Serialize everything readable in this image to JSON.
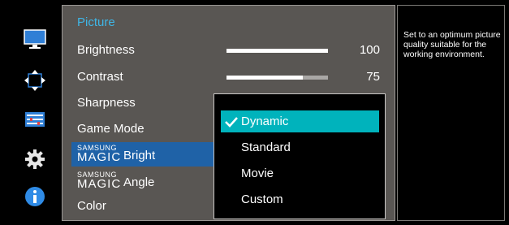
{
  "menu": {
    "title": "Picture",
    "items": [
      {
        "label": "Brightness",
        "value": "100",
        "level": 1.0
      },
      {
        "label": "Contrast",
        "value": "75",
        "level": 0.75
      },
      {
        "label": "Sharpness"
      },
      {
        "label": "Game Mode"
      }
    ],
    "magic_bright": {
      "brand": "SAMSUNG",
      "magic": "MAGIC",
      "label": "Bright"
    },
    "magic_angle": {
      "brand": "SAMSUNG",
      "magic": "MAGIC",
      "label": "Angle"
    },
    "color": {
      "label": "Color"
    }
  },
  "popup": {
    "options": [
      {
        "label": "Dynamic",
        "selected": true
      },
      {
        "label": "Standard"
      },
      {
        "label": "Movie"
      },
      {
        "label": "Custom"
      }
    ]
  },
  "description": "Set to an optimum picture quality suitable for the working environment.",
  "sidebar_icons": [
    "monitor-icon",
    "move-arrows-icon",
    "settings-list-icon",
    "gear-icon",
    "info-icon"
  ],
  "colors": {
    "accent_title": "#3fb6e6",
    "highlight": "#1f62a7",
    "active_option": "#00b3bc"
  }
}
